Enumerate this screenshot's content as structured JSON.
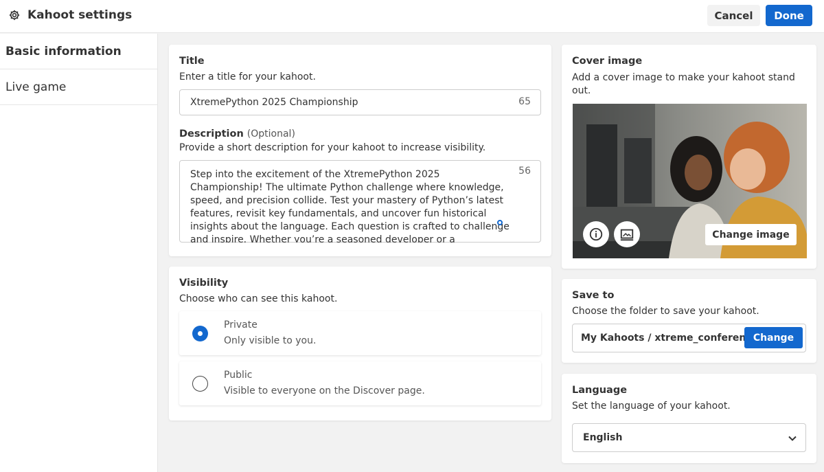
{
  "header": {
    "title": "Kahoot settings",
    "cancel_label": "Cancel",
    "done_label": "Done"
  },
  "sidebar": {
    "items": [
      {
        "label": "Basic information",
        "active": true
      },
      {
        "label": "Live game",
        "active": false
      }
    ]
  },
  "title_section": {
    "label": "Title",
    "hint": "Enter a title for your kahoot.",
    "value": "XtremePython 2025 Championship",
    "counter": "65"
  },
  "description_section": {
    "label": "Description",
    "optional": "(Optional)",
    "hint": "Provide a short description for your kahoot to increase visibility.",
    "value": "Step into the excitement of the XtremePython 2025 Championship! The ultimate Python challenge where knowledge, speed, and precision collide. Test your mastery of Python’s latest features, revisit key fundamentals, and uncover fun historical insights about the language. Each question is crafted to challenge and inspire. Whether you’re a seasoned developer or a passionate learner, this is",
    "counter": "56"
  },
  "visibility_section": {
    "label": "Visibility",
    "hint": "Choose who can see this kahoot.",
    "options": [
      {
        "title": "Private",
        "desc": "Only visible to you.",
        "selected": true
      },
      {
        "title": "Public",
        "desc": "Visible to everyone on the Discover page.",
        "selected": false
      }
    ]
  },
  "cover_section": {
    "label": "Cover image",
    "hint": "Add a cover image to make your kahoot stand out.",
    "change_label": "Change image",
    "icons": [
      "info-icon",
      "image-edit-icon"
    ]
  },
  "save_section": {
    "label": "Save to",
    "hint": "Choose the folder to save your kahoot.",
    "path": "My Kahoots / xtreme_conferen...",
    "change_label": "Change"
  },
  "language_section": {
    "label": "Language",
    "hint": "Set the language of your kahoot.",
    "value": "English"
  },
  "colors": {
    "accent": "#1368ce",
    "background": "#f2f2f2"
  }
}
